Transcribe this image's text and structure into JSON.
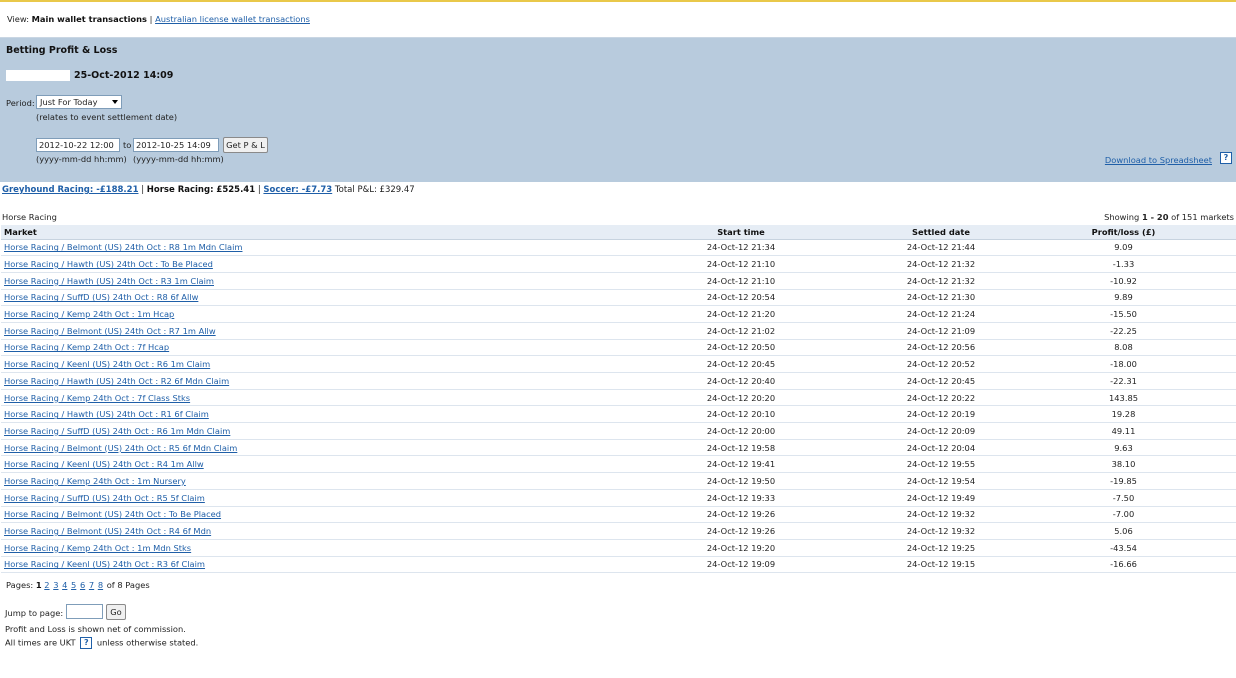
{
  "view": {
    "label": "View:",
    "active": "Main wallet transactions",
    "separator": "|",
    "alt_link": "Australian license wallet transactions"
  },
  "panel": {
    "title": "Betting Profit & Loss",
    "date": "25-Oct-2012 14:09",
    "period_label": "Period:",
    "period_value": "Just For Today",
    "period_note": "(relates to event settlement date)",
    "from_value": "2012-10-22 12:00",
    "to_label": "to",
    "to_value": "2012-10-25 14:09",
    "get_button": "Get P & L",
    "format_hint": "(yyyy-mm-dd hh:mm)",
    "download_link": "Download to Spreadsheet",
    "help": "?"
  },
  "summary": {
    "greyhound": "Greyhound Racing: -£188.21",
    "horse": "Horse Racing: £525.41",
    "soccer": "Soccer: -£7.73",
    "total_label": "Total P&L:",
    "total_value": "£329.47",
    "sep": "|"
  },
  "table": {
    "section": "Horse Racing",
    "showing_prefix": "Showing",
    "showing_range": "1 - 20",
    "showing_suffix": "of 151 markets",
    "headers": [
      "Market",
      "Start time",
      "Settled date",
      "Profit/loss (£)"
    ],
    "rows": [
      {
        "market": "Horse Racing / Belmont (US) 24th Oct : R8 1m Mdn Claim",
        "start": "24-Oct-12 21:34",
        "settled": "24-Oct-12 21:44",
        "pl": "9.09"
      },
      {
        "market": "Horse Racing / Hawth (US) 24th Oct : To Be Placed",
        "start": "24-Oct-12 21:10",
        "settled": "24-Oct-12 21:32",
        "pl": "-1.33"
      },
      {
        "market": "Horse Racing / Hawth (US) 24th Oct : R3 1m Claim",
        "start": "24-Oct-12 21:10",
        "settled": "24-Oct-12 21:32",
        "pl": "-10.92"
      },
      {
        "market": "Horse Racing / SuffD (US) 24th Oct : R8 6f Allw",
        "start": "24-Oct-12 20:54",
        "settled": "24-Oct-12 21:30",
        "pl": "9.89"
      },
      {
        "market": "Horse Racing / Kemp 24th Oct : 1m Hcap",
        "start": "24-Oct-12 21:20",
        "settled": "24-Oct-12 21:24",
        "pl": "-15.50"
      },
      {
        "market": "Horse Racing / Belmont (US) 24th Oct : R7 1m Allw",
        "start": "24-Oct-12 21:02",
        "settled": "24-Oct-12 21:09",
        "pl": "-22.25"
      },
      {
        "market": "Horse Racing / Kemp 24th Oct : 7f Hcap",
        "start": "24-Oct-12 20:50",
        "settled": "24-Oct-12 20:56",
        "pl": "8.08"
      },
      {
        "market": "Horse Racing / Keenl (US) 24th Oct : R6 1m Claim",
        "start": "24-Oct-12 20:45",
        "settled": "24-Oct-12 20:52",
        "pl": "-18.00"
      },
      {
        "market": "Horse Racing / Hawth (US) 24th Oct : R2 6f Mdn Claim",
        "start": "24-Oct-12 20:40",
        "settled": "24-Oct-12 20:45",
        "pl": "-22.31"
      },
      {
        "market": "Horse Racing / Kemp 24th Oct : 7f Class Stks",
        "start": "24-Oct-12 20:20",
        "settled": "24-Oct-12 20:22",
        "pl": "143.85"
      },
      {
        "market": "Horse Racing / Hawth (US) 24th Oct : R1 6f Claim",
        "start": "24-Oct-12 20:10",
        "settled": "24-Oct-12 20:19",
        "pl": "19.28"
      },
      {
        "market": "Horse Racing / SuffD (US) 24th Oct : R6 1m Mdn Claim",
        "start": "24-Oct-12 20:00",
        "settled": "24-Oct-12 20:09",
        "pl": "49.11"
      },
      {
        "market": "Horse Racing / Belmont (US) 24th Oct : R5 6f Mdn Claim",
        "start": "24-Oct-12 19:58",
        "settled": "24-Oct-12 20:04",
        "pl": "9.63"
      },
      {
        "market": "Horse Racing / Keenl (US) 24th Oct : R4 1m Allw",
        "start": "24-Oct-12 19:41",
        "settled": "24-Oct-12 19:55",
        "pl": "38.10"
      },
      {
        "market": "Horse Racing / Kemp 24th Oct : 1m Nursery",
        "start": "24-Oct-12 19:50",
        "settled": "24-Oct-12 19:54",
        "pl": "-19.85"
      },
      {
        "market": "Horse Racing / SuffD (US) 24th Oct : R5 5f Claim",
        "start": "24-Oct-12 19:33",
        "settled": "24-Oct-12 19:49",
        "pl": "-7.50"
      },
      {
        "market": "Horse Racing / Belmont (US) 24th Oct : To Be Placed",
        "start": "24-Oct-12 19:26",
        "settled": "24-Oct-12 19:32",
        "pl": "-7.00"
      },
      {
        "market": "Horse Racing / Belmont (US) 24th Oct : R4 6f Mdn",
        "start": "24-Oct-12 19:26",
        "settled": "24-Oct-12 19:32",
        "pl": "5.06"
      },
      {
        "market": "Horse Racing / Kemp 24th Oct : 1m Mdn Stks",
        "start": "24-Oct-12 19:20",
        "settled": "24-Oct-12 19:25",
        "pl": "-43.54"
      },
      {
        "market": "Horse Racing / Keenl (US) 24th Oct : R3 6f Claim",
        "start": "24-Oct-12 19:09",
        "settled": "24-Oct-12 19:15",
        "pl": "-16.66"
      }
    ]
  },
  "pager": {
    "label": "Pages:",
    "current": "1",
    "pages": [
      "2",
      "3",
      "4",
      "5",
      "6",
      "7",
      "8"
    ],
    "suffix": "of 8 Pages",
    "jump_label": "Jump to page:",
    "go_button": "Go"
  },
  "notes": {
    "commission": "Profit and Loss is shown net of commission.",
    "times_prefix": "All times are UKT",
    "times_suffix": "unless otherwise stated."
  }
}
